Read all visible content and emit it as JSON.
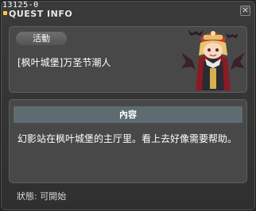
{
  "header": {
    "quest_id": "13125-0",
    "title": "QUEST INFO"
  },
  "quest": {
    "badge_label": "活動",
    "name": "[枫叶城堡]万圣节潮人"
  },
  "content": {
    "header_label": "內容",
    "description": "幻影站在枫叶城堡的主厅里。看上去好像需要帮助。"
  },
  "status": {
    "text": "狀態:  可開始"
  },
  "colors": {
    "background": "#2f2f2f",
    "panel": "#484848",
    "content_header": "#5e6b72",
    "accent_dot": "#ffcc33"
  },
  "icons": {
    "close": "close-icon",
    "portrait": "npc-portrait-icon"
  }
}
